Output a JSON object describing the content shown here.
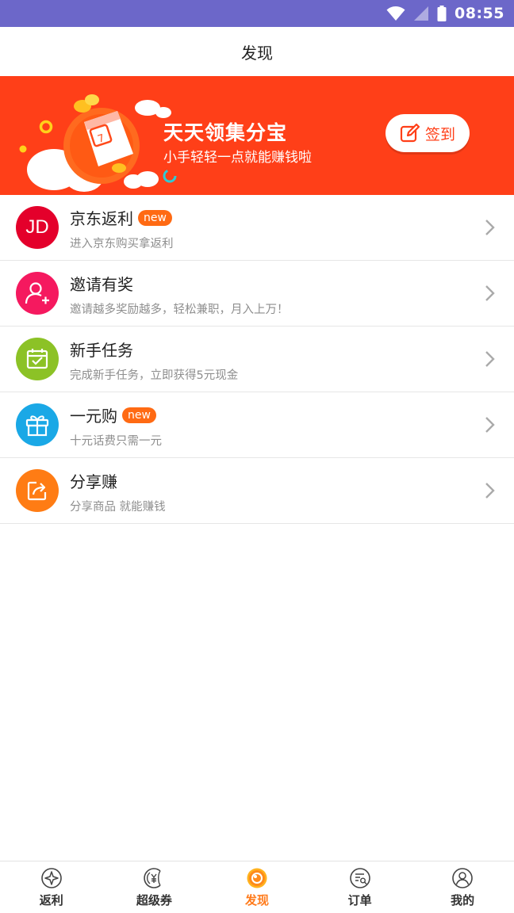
{
  "status_bar": {
    "time": "08:55"
  },
  "header": {
    "title": "发现"
  },
  "banner": {
    "title": "天天领集分宝",
    "subtitle": "小手轻轻一点就能赚钱啦",
    "calendar_day": "7",
    "signin_label": "签到"
  },
  "list": [
    {
      "title": "京东返利",
      "badge": "new",
      "subtitle": "进入京东购买拿返利",
      "icon": "jd-logo-icon",
      "icon_text": "JD",
      "color": "#e4002b"
    },
    {
      "title": "邀请有奖",
      "badge": "",
      "subtitle": "邀请越多奖励越多，轻松兼职，月入上万！",
      "icon": "user-plus-icon",
      "color": "#f5195f"
    },
    {
      "title": "新手任务",
      "badge": "",
      "subtitle": "完成新手任务，立即获得5元现金",
      "icon": "calendar-check-icon",
      "color": "#8cc226"
    },
    {
      "title": "一元购",
      "badge": "new",
      "subtitle": "十元话费只需一元",
      "icon": "gift-icon",
      "color": "#1aa8e6"
    },
    {
      "title": "分享赚",
      "badge": "",
      "subtitle": "分享商品 就能赚钱",
      "icon": "share-icon",
      "color": "#ff7c14"
    }
  ],
  "tabbar": {
    "items": [
      {
        "label": "返利",
        "icon": "rebate-icon",
        "active": false
      },
      {
        "label": "超级券",
        "icon": "coupon-icon",
        "active": false
      },
      {
        "label": "发现",
        "icon": "discover-icon",
        "active": true
      },
      {
        "label": "订单",
        "icon": "order-icon",
        "active": false
      },
      {
        "label": "我的",
        "icon": "profile-icon",
        "active": false
      }
    ],
    "active_color": "#ff7a1a"
  }
}
